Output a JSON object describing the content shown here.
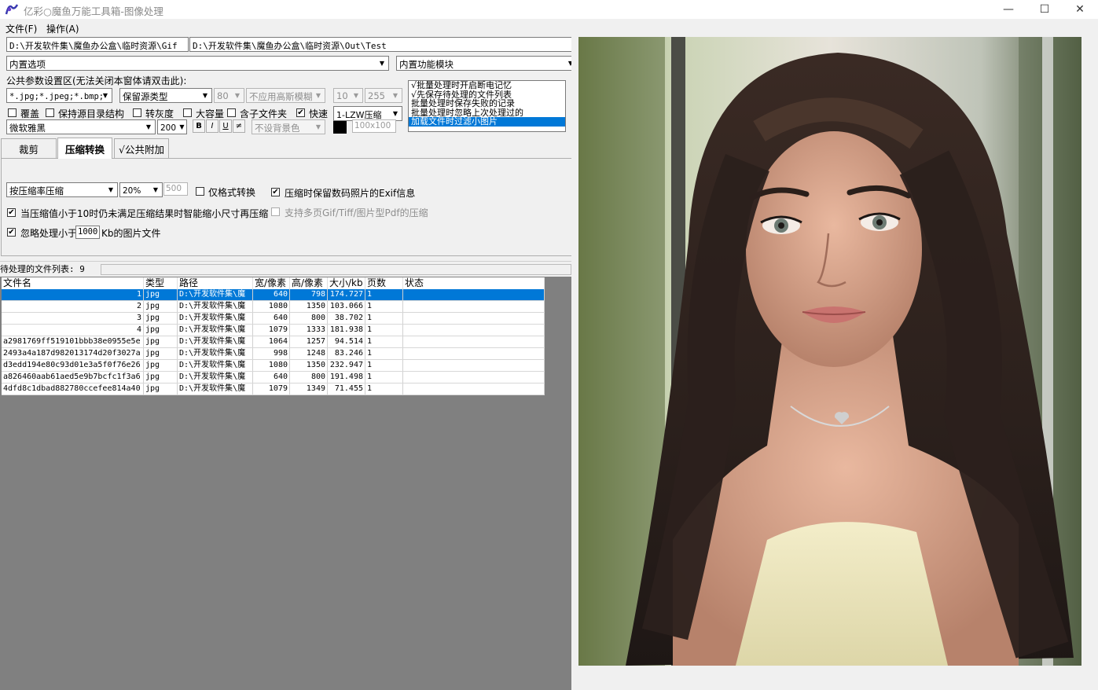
{
  "window": {
    "title": "亿彩○魔鱼万能工具箱-图像处理",
    "minimize": "—",
    "maximize": "☐",
    "close": "✕"
  },
  "menu": {
    "file": "文件(F)",
    "operate": "操作(A)"
  },
  "paths": {
    "input": "D:\\开发软件集\\魔鱼办公盒\\临时资源\\Gif",
    "output": "D:\\开发软件集\\魔鱼办公盒\\临时资源\\Out\\Test"
  },
  "builtin": {
    "options": "内置选项",
    "module": "内置功能模块"
  },
  "params": {
    "header": "公共参数设置区(无法关闭本窗体请双击此):",
    "filter": "*.jpg;*.jpeg;*.bmp;",
    "keep_type": "保留源类型",
    "quality": "80",
    "gauss": "不应用高斯模糊",
    "min_val": "10",
    "max_val": "255",
    "overwrite": "覆盖",
    "keep_dir": "保持源目录结构",
    "gray": "转灰度",
    "large": "大容量",
    "subfolder": "含子文件夹",
    "fast": "快速",
    "lzw": "1-LZW压缩",
    "font": "微软雅黑",
    "font_size": "200",
    "bold": "B",
    "italic": "I",
    "underline": "U",
    "strike": "≠",
    "bg": "不设背景色",
    "size_box": "100x100"
  },
  "options_list": [
    "√批量处理时开启断电记忆",
    "√先保存待处理的文件列表",
    "批量处理时保存失败的记录",
    "批量处理时忽略上次处理过的",
    "加载文件时过滤小图片"
  ],
  "tabs": [
    "裁剪",
    "压缩转换",
    "√公共附加"
  ],
  "compress": {
    "mode": "按压缩率压缩",
    "rate": "20%",
    "size": "500",
    "format_only": "仅格式转换",
    "keep_exif": "压缩时保留数码照片的Exif信息",
    "smart_resize": "当压缩值小于10时仍未满足压缩结果时智能缩小尺寸再压缩",
    "multipage": "支持多页Gif/Tiff/图片型Pdf的压缩",
    "ignore_prefix": "忽略处理小于",
    "ignore_kb": "1000",
    "ignore_suffix": "Kb的图片文件"
  },
  "filelist": {
    "label": "待处理的文件列表: 9",
    "columns": [
      "文件名",
      "类型",
      "路径",
      "宽/像素",
      "高/像素",
      "大小/kb",
      "页数",
      "状态"
    ],
    "rows": [
      [
        "1",
        "jpg",
        "D:\\开发软件集\\魔",
        "640",
        "798",
        "174.727",
        "1",
        ""
      ],
      [
        "2",
        "jpg",
        "D:\\开发软件集\\魔",
        "1080",
        "1350",
        "103.066",
        "1",
        ""
      ],
      [
        "3",
        "jpg",
        "D:\\开发软件集\\魔",
        "640",
        "800",
        "38.702",
        "1",
        ""
      ],
      [
        "4",
        "jpg",
        "D:\\开发软件集\\魔",
        "1079",
        "1333",
        "181.938",
        "1",
        ""
      ],
      [
        "a2981769ff519101bbb38e0955e5e",
        "jpg",
        "D:\\开发软件集\\魔",
        "1064",
        "1257",
        "94.514",
        "1",
        ""
      ],
      [
        "2493a4a187d982013174d20f3027a",
        "jpg",
        "D:\\开发软件集\\魔",
        "998",
        "1248",
        "83.246",
        "1",
        ""
      ],
      [
        "d3edd194e80c93d01e3a5f0f76e26",
        "jpg",
        "D:\\开发软件集\\魔",
        "1080",
        "1350",
        "232.947",
        "1",
        ""
      ],
      [
        "a826460aab61aed5e9b7bcfc1f3a6",
        "jpg",
        "D:\\开发软件集\\魔",
        "640",
        "800",
        "191.498",
        "1",
        ""
      ],
      [
        "4dfd8c1dbad882780ccefee814a40",
        "jpg",
        "D:\\开发软件集\\魔",
        "1079",
        "1349",
        "71.455",
        "1",
        ""
      ]
    ]
  },
  "colors": {
    "selection": "#0078d7",
    "list_bg": "#808080",
    "accent": "#0078d7"
  }
}
